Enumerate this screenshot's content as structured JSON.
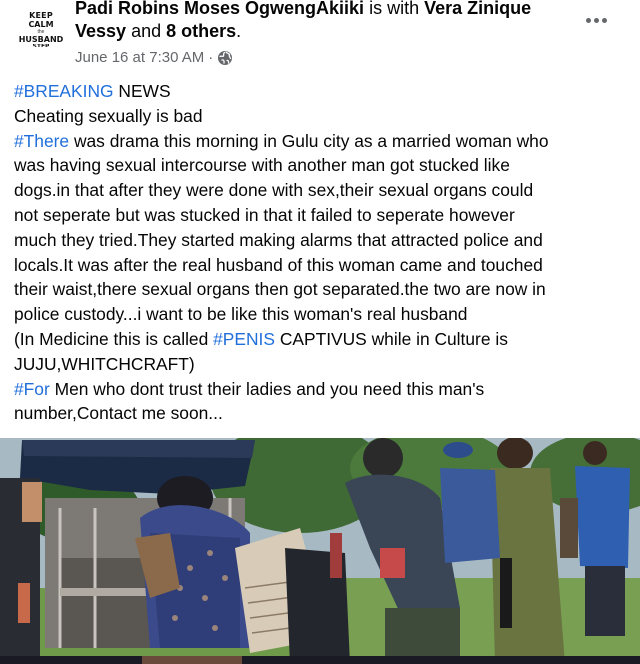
{
  "post": {
    "avatar": {
      "line1": "KEEP",
      "line2": "CALM",
      "line3": "the",
      "line4": "HUSBAND",
      "line5": "STEP"
    },
    "author": "Padi Robins Moses OgwengAkiiki",
    "is_with": "is with",
    "tagged_name": "Vera Zinique Vessy",
    "and_text": "and",
    "others": "8 others",
    "period": ".",
    "timestamp": "June 16 at 7:30 AM",
    "separator": "·",
    "privacy_icon": "globe-icon",
    "more_icon": "more-options-icon",
    "lines": [
      [
        {
          "tag": "#BREAKING"
        },
        {
          "text": " NEWS"
        }
      ],
      [
        {
          "text": " Cheating sexually is bad"
        }
      ],
      [
        {
          "tag": "#There"
        },
        {
          "text": " was drama this morning in Gulu city as a married woman who"
        }
      ],
      [
        {
          "text": "was having sexual intercourse with another man got stucked like"
        }
      ],
      [
        {
          "text": "dogs.in that after they were done with sex,their sexual organs could"
        }
      ],
      [
        {
          "text": "not seperate but was stucked in that it failed to seperate however"
        }
      ],
      [
        {
          "text": "much they tried.They started making alarms that attracted police and"
        }
      ],
      [
        {
          "text": "locals.It was after the real husband of this woman came and touched"
        }
      ],
      [
        {
          "text": "their waist,there sexual organs then got separated.the two are now in"
        }
      ],
      [
        {
          "text": "police custody...i want to be like this woman's real husband"
        }
      ],
      [
        {
          "text": "(In Medicine this is called "
        },
        {
          "tag": "#PENIS"
        },
        {
          "text": " CAPTIVUS while in Culture is"
        }
      ],
      [
        {
          "text": "JUJU,WHITCHCRAFT)"
        }
      ],
      [
        {
          "tag": "#For"
        },
        {
          "text": " Men who dont trust their ladies and you need this man's"
        }
      ],
      [
        {
          "text": "number,Contact me soon..."
        }
      ]
    ],
    "colors": {
      "hashtag": "#216fdb",
      "secondary_text": "#65676b",
      "primary_text": "#050505"
    }
  }
}
